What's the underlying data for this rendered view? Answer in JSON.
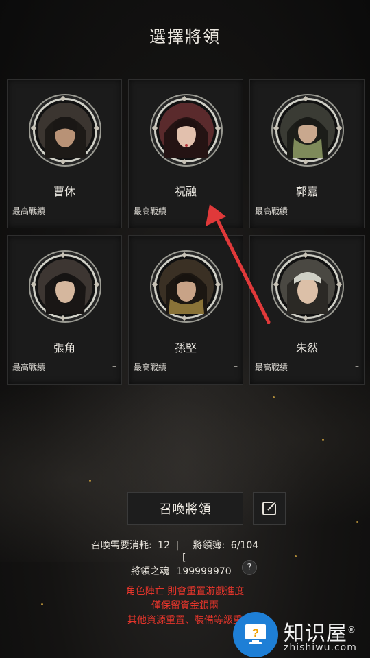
{
  "header": {
    "title": "選擇將領"
  },
  "generals": [
    {
      "name": "曹休",
      "stat_label": "最高戰績",
      "stat_value": "–",
      "portrait": "general-portrait"
    },
    {
      "name": "祝融",
      "stat_label": "最高戰績",
      "stat_value": "–",
      "portrait": "general-portrait"
    },
    {
      "name": "郭嘉",
      "stat_label": "最高戰績",
      "stat_value": "–",
      "portrait": "general-portrait"
    },
    {
      "name": "張角",
      "stat_label": "最高戰績",
      "stat_value": "–",
      "portrait": "general-portrait"
    },
    {
      "name": "孫堅",
      "stat_label": "最高戰績",
      "stat_value": "–",
      "portrait": "general-portrait"
    },
    {
      "name": "朱然",
      "stat_label": "最高戰績",
      "stat_value": "–",
      "portrait": "general-portrait"
    }
  ],
  "actions": {
    "summon_label": "召喚將領",
    "edit_icon": "edit-icon"
  },
  "summon_info": {
    "cost_label": "召喚需要消耗:",
    "cost_value": "12",
    "separator": "|",
    "roster_label": "將領簿:",
    "roster_value": "6/104",
    "bracket": "[",
    "soul_label": "將領之魂",
    "soul_value": "199999970",
    "help_label": "?"
  },
  "warning": {
    "line1": "角色陣亡 則會重置游戲進度",
    "line2": "僅保留資金銀兩",
    "line3": "其他資源重置、裝備等級重"
  },
  "watermark": {
    "text": "知识屋",
    "sub": "zhishiwu.com",
    "mark": "®"
  },
  "colors": {
    "warning": "#e5352b",
    "accent_arrow": "#e0393a",
    "watermark_blue": "#1e7fd6"
  }
}
